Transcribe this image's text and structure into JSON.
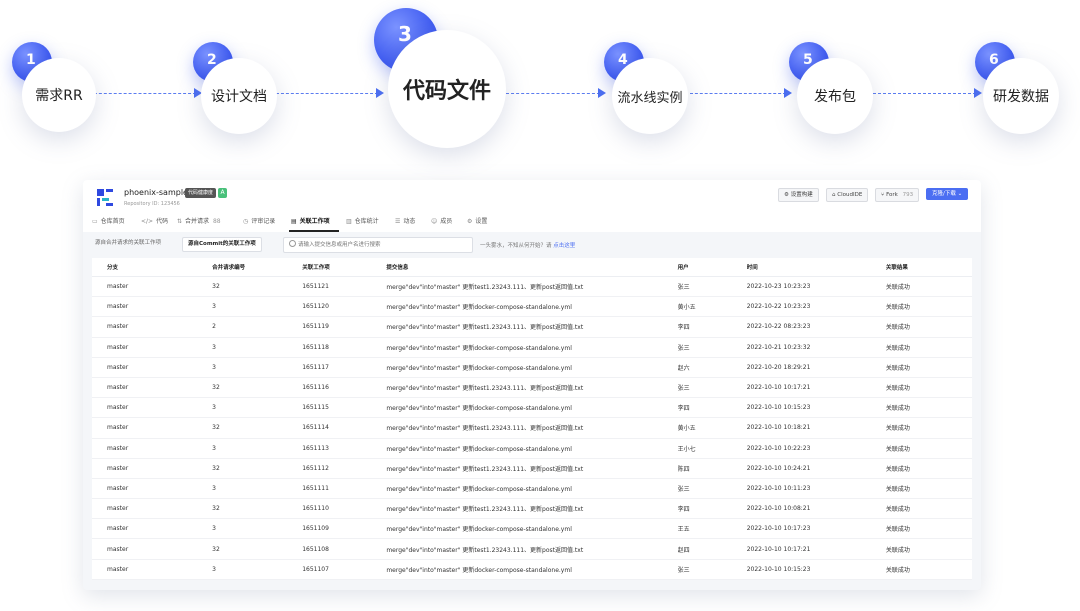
{
  "pipeline": {
    "stages": [
      {
        "num": "1",
        "label": "需求RR"
      },
      {
        "num": "2",
        "label": "设计文档"
      },
      {
        "num": "3",
        "label": "代码文件"
      },
      {
        "num": "4",
        "label": "流水线实例"
      },
      {
        "num": "5",
        "label": "发布包"
      },
      {
        "num": "6",
        "label": "研发数据"
      }
    ]
  },
  "repo": {
    "name": "phoenix-sample",
    "id_text": "Repository ID: 123456",
    "health_label": "代码健康度",
    "health_grade": "A"
  },
  "actions": {
    "build": "设置构建",
    "cloudide": "CloudIDE",
    "fork": "Fork",
    "fork_count": "793",
    "clone": "克隆/下载 ⌄"
  },
  "tabs": [
    {
      "icon": "home-icon",
      "label": "仓库首页"
    },
    {
      "icon": "code-icon",
      "label": "代码"
    },
    {
      "icon": "merge-icon",
      "label": "合并请求",
      "count": "88"
    },
    {
      "icon": "review-icon",
      "label": "评审记录"
    },
    {
      "icon": "workitem-icon",
      "label": "关联工作项"
    },
    {
      "icon": "stats-icon",
      "label": "仓库统计"
    },
    {
      "icon": "activity-icon",
      "label": "动态"
    },
    {
      "icon": "member-icon",
      "label": "成员"
    },
    {
      "icon": "settings-icon",
      "label": "设置"
    }
  ],
  "filters": {
    "from_mr": "源自合并请求的关联工作项",
    "from_commit": "源自Commit的关联工作项",
    "search_placeholder": "请输入提交信息或用户名进行搜索",
    "hint": "一头雾水，不知从何开始？请",
    "hint_link": "点击这里"
  },
  "table": {
    "columns": [
      "分支",
      "合并请求编号",
      "关联工作项",
      "提交信息",
      "用户",
      "时间",
      "关联结果"
    ],
    "rows": [
      [
        "master",
        "32",
        "1651121",
        "merge\"dev\"into\"master\" 更新test1.23243.111、更新post返回值.txt",
        "张三",
        "2022-10-23 10:23:23",
        "关联成功"
      ],
      [
        "master",
        "3",
        "1651120",
        "merge\"dev\"into\"master\" 更新docker-compose-standalone.yml",
        "黄小五",
        "2022-10-22 10:23:23",
        "关联成功"
      ],
      [
        "master",
        "2",
        "1651119",
        "merge\"dev\"into\"master\" 更新test1.23243.111、更新post返回值.txt",
        "李四",
        "2022-10-22 08:23:23",
        "关联成功"
      ],
      [
        "master",
        "3",
        "1651118",
        "merge\"dev\"into\"master\" 更新docker-compose-standalone.yml",
        "张三",
        "2022-10-21 10:23:32",
        "关联成功"
      ],
      [
        "master",
        "3",
        "1651117",
        "merge\"dev\"into\"master\" 更新docker-compose-standalone.yml",
        "赵六",
        "2022-10-20 18:29:21",
        "关联成功"
      ],
      [
        "master",
        "32",
        "1651116",
        "merge\"dev\"into\"master\" 更新test1.23243.111、更新post返回值.txt",
        "张三",
        "2022-10-10 10:17:21",
        "关联成功"
      ],
      [
        "master",
        "3",
        "1651115",
        "merge\"dev\"into\"master\" 更新docker-compose-standalone.yml",
        "李四",
        "2022-10-10 10:15:23",
        "关联成功"
      ],
      [
        "master",
        "32",
        "1651114",
        "merge\"dev\"into\"master\" 更新test1.23243.111、更新post返回值.txt",
        "黄小五",
        "2022-10-10 10:18:21",
        "关联成功"
      ],
      [
        "master",
        "3",
        "1651113",
        "merge\"dev\"into\"master\" 更新docker-compose-standalone.yml",
        "王小七",
        "2022-10-10 10:22:23",
        "关联成功"
      ],
      [
        "master",
        "32",
        "1651112",
        "merge\"dev\"into\"master\" 更新test1.23243.111、更新post返回值.txt",
        "陈四",
        "2022-10-10 10:24:21",
        "关联成功"
      ],
      [
        "master",
        "3",
        "1651111",
        "merge\"dev\"into\"master\" 更新docker-compose-standalone.yml",
        "张三",
        "2022-10-10 10:11:23",
        "关联成功"
      ],
      [
        "master",
        "32",
        "1651110",
        "merge\"dev\"into\"master\" 更新test1.23243.111、更新post返回值.txt",
        "李四",
        "2022-10-10 10:08:21",
        "关联成功"
      ],
      [
        "master",
        "3",
        "1651109",
        "merge\"dev\"into\"master\" 更新docker-compose-standalone.yml",
        "王五",
        "2022-10-10 10:17:23",
        "关联成功"
      ],
      [
        "master",
        "32",
        "1651108",
        "merge\"dev\"into\"master\" 更新test1.23243.111、更新post返回值.txt",
        "赵四",
        "2022-10-10 10:17:21",
        "关联成功"
      ],
      [
        "master",
        "3",
        "1651107",
        "merge\"dev\"into\"master\" 更新docker-compose-standalone.yml",
        "张三",
        "2022-10-10 10:15:23",
        "关联成功"
      ]
    ]
  },
  "colors": {
    "accent": "#4b6ef2",
    "success": "#49c07a"
  }
}
